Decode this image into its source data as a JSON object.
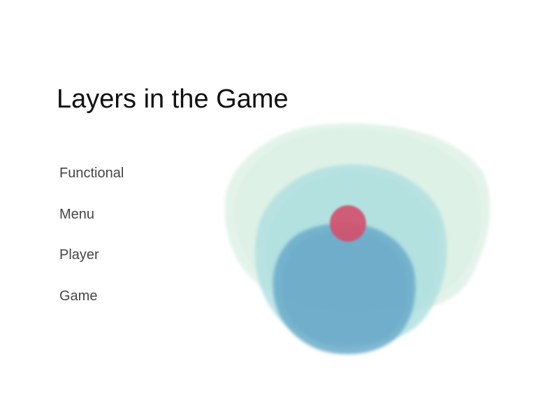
{
  "slide": {
    "title": "Layers in the Game"
  },
  "layers": [
    {
      "label": "Functional",
      "color": "#d9efe2"
    },
    {
      "label": "Menu",
      "color": "#aedfe0"
    },
    {
      "label": "Player",
      "color": "#6aaac9"
    },
    {
      "label": "Game",
      "color": "#d4506b"
    }
  ]
}
